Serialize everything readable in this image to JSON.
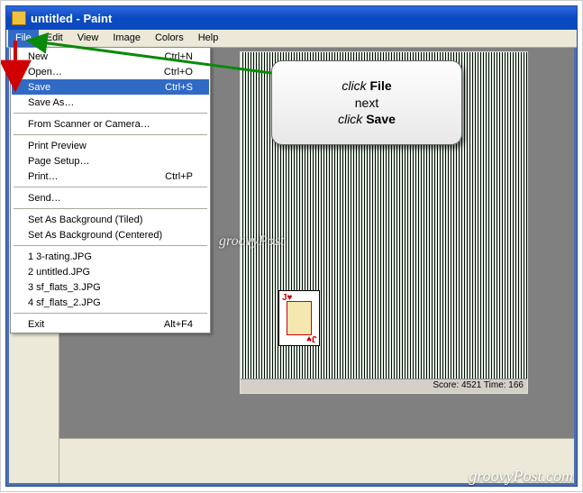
{
  "window": {
    "title": "untitled - Paint"
  },
  "menubar": {
    "items": [
      "File",
      "Edit",
      "View",
      "Image",
      "Colors",
      "Help"
    ],
    "active_index": 0
  },
  "file_menu": {
    "groups": [
      [
        {
          "label": "New",
          "shortcut": "Ctrl+N"
        },
        {
          "label": "Open…",
          "shortcut": "Ctrl+O"
        },
        {
          "label": "Save",
          "shortcut": "Ctrl+S",
          "highlighted": true
        },
        {
          "label": "Save As…",
          "shortcut": ""
        }
      ],
      [
        {
          "label": "From Scanner or Camera…",
          "shortcut": ""
        }
      ],
      [
        {
          "label": "Print Preview",
          "shortcut": ""
        },
        {
          "label": "Page Setup…",
          "shortcut": ""
        },
        {
          "label": "Print…",
          "shortcut": "Ctrl+P"
        }
      ],
      [
        {
          "label": "Send…",
          "shortcut": ""
        }
      ],
      [
        {
          "label": "Set As Background (Tiled)",
          "shortcut": ""
        },
        {
          "label": "Set As Background (Centered)",
          "shortcut": ""
        }
      ],
      [
        {
          "label": "1 3-rating.JPG",
          "shortcut": ""
        },
        {
          "label": "2 untitled.JPG",
          "shortcut": ""
        },
        {
          "label": "3 sf_flats_3.JPG",
          "shortcut": ""
        },
        {
          "label": "4 sf_flats_2.JPG",
          "shortcut": ""
        }
      ],
      [
        {
          "label": "Exit",
          "shortcut": "Alt+F4"
        }
      ]
    ]
  },
  "callout": {
    "line1_em": "click ",
    "line1_bold": "File",
    "line2": "next",
    "line3_em": "click ",
    "line3_bold": "Save"
  },
  "canvas": {
    "status_text": "Score: 4521 Time: 166"
  },
  "watermark": "groovyPost",
  "brand": "groovyPost.com"
}
